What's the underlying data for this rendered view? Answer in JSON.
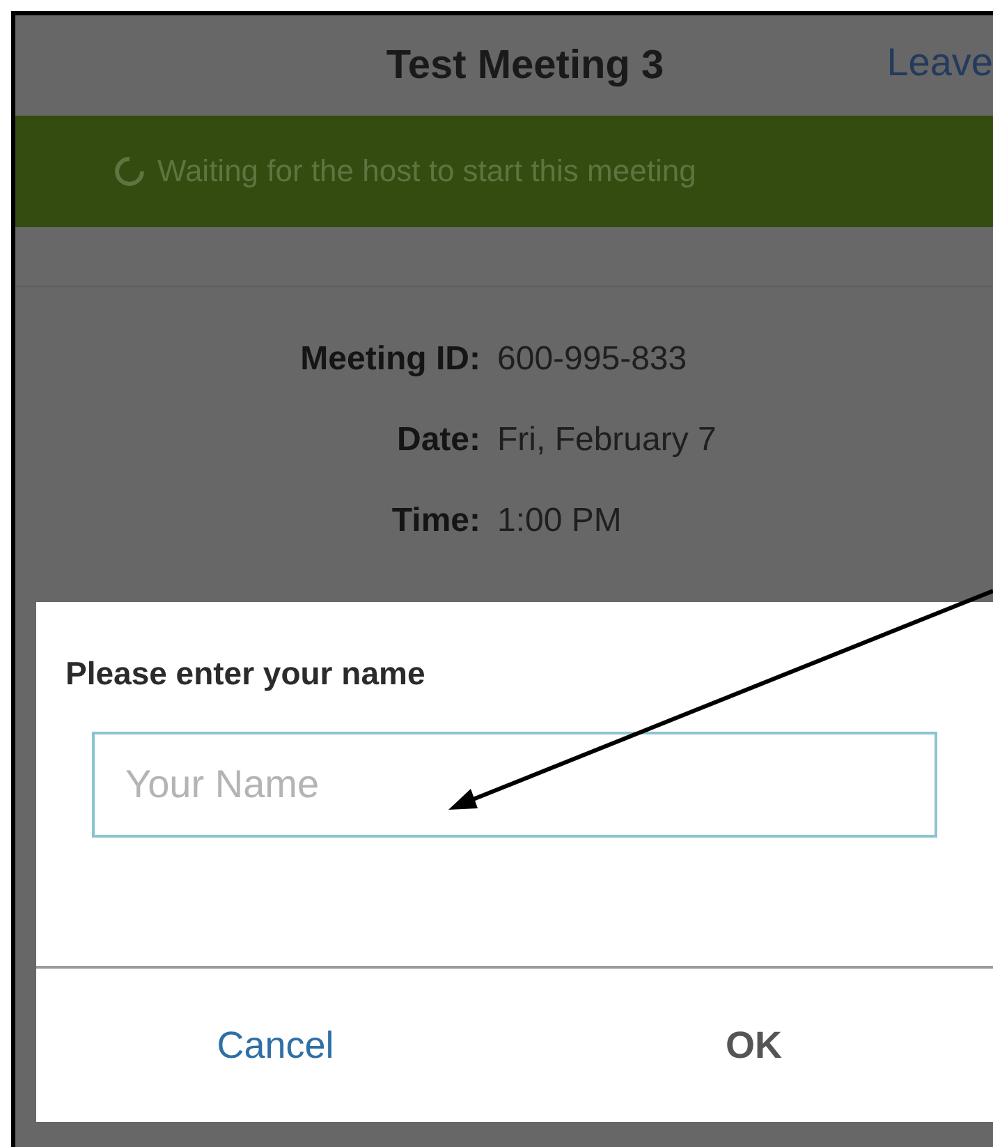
{
  "header": {
    "title": "Test Meeting 3",
    "leave": "Leave"
  },
  "banner": {
    "text": "Waiting for the host to start this meeting"
  },
  "details": [
    {
      "label": "Meeting ID:",
      "value": "600-995-833"
    },
    {
      "label": "Date:",
      "value": "Fri, February 7"
    },
    {
      "label": "Time:",
      "value": "1:00 PM"
    }
  ],
  "dialog": {
    "title": "Please enter your name",
    "name_field": {
      "placeholder": "Your Name"
    },
    "buttons": [
      {
        "label": "Cancel",
        "kind": "cancel"
      },
      {
        "label": "OK",
        "kind": "confirm"
      }
    ]
  }
}
